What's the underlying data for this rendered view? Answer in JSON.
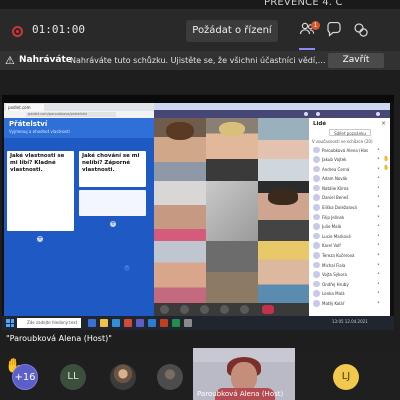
{
  "window": {
    "title": "PREVENCE 4. C"
  },
  "toolbar": {
    "timer": "01:01:00",
    "ask_control_label": "Požádat o řízení",
    "participants_badge": "1",
    "icons": [
      "participants-icon",
      "chat-icon",
      "reactions-icon"
    ]
  },
  "banner": {
    "lead": "Nahráváte",
    "message": "Nahráváte tuto schůzku. Ujistěte se, že všichni účastníci vědí, že jsou nahr...",
    "close_label": "Zavřít"
  },
  "shared_screen": {
    "whiteboard": {
      "tab_label": "padlet.com",
      "url": "padlet.com/paroubkova/pratelstvi",
      "title": "Přátelství",
      "subtitle": "Vyjmenuj a ohodnoť vlastnosti",
      "columns": [
        {
          "heading": "Jaké vlastnosti se mi líbí? Kladné vlastnosti."
        },
        {
          "heading": "Jaké chování se mi nelíbí? Záporné vlastnosti."
        }
      ]
    },
    "participants_panel": {
      "title": "Lidé",
      "share_label": "Sdílet pozvánku",
      "section_label": "V současnosti ve schůzce (20)",
      "people": [
        {
          "name": "Paroubková Alena (Host)",
          "hand": false
        },
        {
          "name": "Jakub Vojtek",
          "hand": true
        },
        {
          "name": "Andrea Černá",
          "hand": true
        },
        {
          "name": "Adam Novák",
          "hand": false
        },
        {
          "name": "Natálie Klíma",
          "hand": false
        },
        {
          "name": "Daniel Beneš",
          "hand": false
        },
        {
          "name": "Eliška Doležalová",
          "hand": false
        },
        {
          "name": "Filip Jelínek",
          "hand": false
        },
        {
          "name": "Julie Malá",
          "hand": false
        },
        {
          "name": "Lucie Marková",
          "hand": false
        },
        {
          "name": "Karel Volf",
          "hand": false
        },
        {
          "name": "Tereza Kučerová",
          "hand": false
        },
        {
          "name": "Michal Fiala",
          "hand": false
        },
        {
          "name": "Vojta Sýkora",
          "hand": false
        },
        {
          "name": "Ondřej Hrubý",
          "hand": false
        },
        {
          "name": "Lenka Malá",
          "hand": false
        },
        {
          "name": "Matěj Kolář",
          "hand": false
        }
      ]
    },
    "taskbar": {
      "search_placeholder": "Zde zadejte hledaný text",
      "clock": "13:05 12.04.2021"
    }
  },
  "presenter_label": "\"Paroubková Alena (Host)\"",
  "bottom_row": {
    "overflow_count": "+16",
    "avatar_ll": "LL",
    "avatar_lj": "LJ",
    "speaker_label": "Paroubková Alena (Host)"
  }
}
